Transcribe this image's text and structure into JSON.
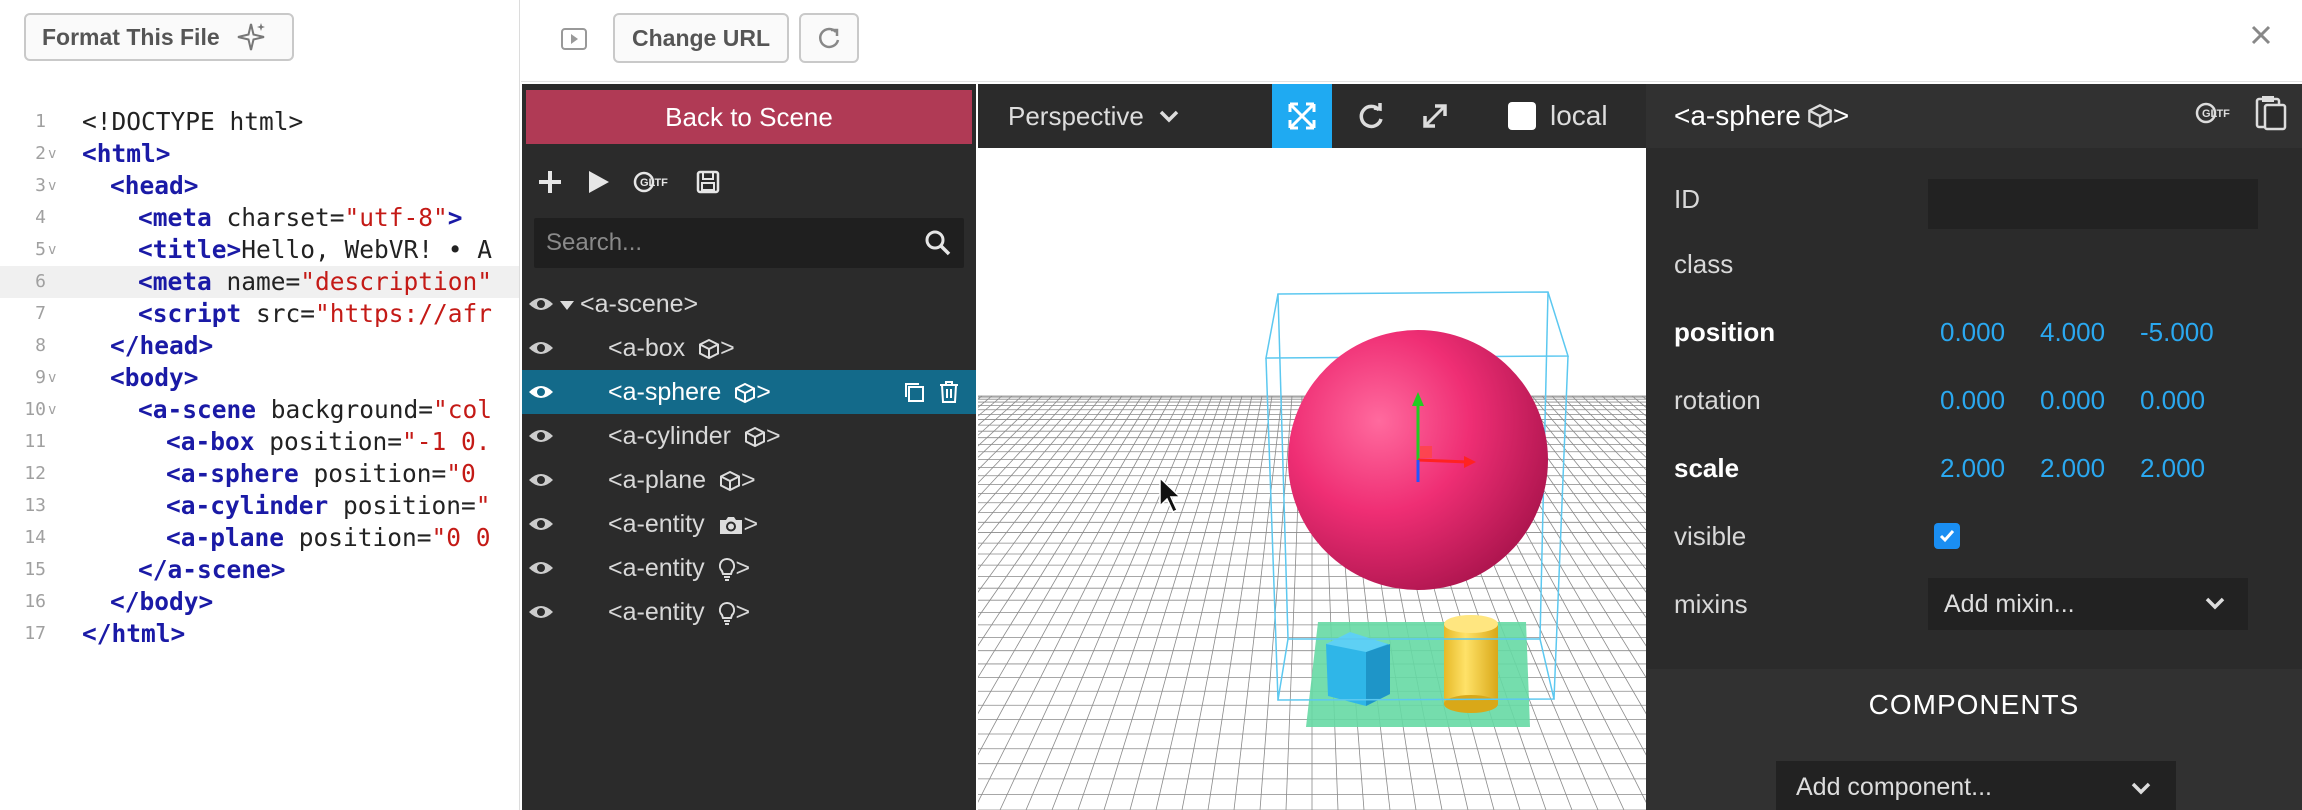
{
  "editor": {
    "format_button": "Format This File",
    "lines": [
      {
        "n": "1",
        "fold": ""
      },
      {
        "n": "2",
        "fold": "v"
      },
      {
        "n": "3",
        "fold": "v"
      },
      {
        "n": "4",
        "fold": ""
      },
      {
        "n": "5",
        "fold": "v"
      },
      {
        "n": "6",
        "fold": ""
      },
      {
        "n": "7",
        "fold": ""
      },
      {
        "n": "8",
        "fold": ""
      },
      {
        "n": "9",
        "fold": "v"
      },
      {
        "n": "10",
        "fold": "v"
      },
      {
        "n": "11",
        "fold": ""
      },
      {
        "n": "12",
        "fold": ""
      },
      {
        "n": "13",
        "fold": ""
      },
      {
        "n": "14",
        "fold": ""
      },
      {
        "n": "15",
        "fold": ""
      },
      {
        "n": "16",
        "fold": ""
      },
      {
        "n": "17",
        "fold": ""
      }
    ],
    "code": {
      "l1": "<!DOCTYPE html>",
      "l2_tag": "<html>",
      "l3_tag": "<head>",
      "l4_tag": "<meta",
      "l4_attr": " charset=",
      "l4_str": "\"utf-8\"",
      "l4_end": ">",
      "l5_tag": "<title>",
      "l5_text": "Hello, WebVR! • A",
      "l6_tag": "<meta",
      "l6_attr": " name=",
      "l6_str": "\"description\"",
      "l7_tag": "<script",
      "l7_attr": " src=",
      "l7_str": "\"https://afr",
      "l8_tag": "</head>",
      "l9_tag": "<body>",
      "l10_tag": "<a-scene",
      "l10_attr": " background=",
      "l10_str": "\"col",
      "l11_tag": "<a-box",
      "l11_attr": " position=",
      "l11_str": "\"-1 0.",
      "l12_tag": "<a-sphere",
      "l12_attr": " position=",
      "l12_str": "\"0",
      "l13_tag": "<a-cylinder",
      "l13_attr": " position=",
      "l13_str": "\"",
      "l14_tag": "<a-plane",
      "l14_attr": " position=",
      "l14_str": "\"0 0",
      "l15_tag": "</a-scene>",
      "l16_tag": "</body>",
      "l17_tag": "</html>"
    }
  },
  "preview_bar": {
    "change_url": "Change URL"
  },
  "scene": {
    "back_button": "Back to Scene",
    "search_placeholder": "Search...",
    "tree": [
      {
        "label": "<a-scene>",
        "icon": "none"
      },
      {
        "label": "<a-box",
        "icon": "cube-icon"
      },
      {
        "label": "<a-sphere",
        "icon": "cube-icon"
      },
      {
        "label": "<a-cylinder",
        "icon": "cube-icon"
      },
      {
        "label": "<a-plane",
        "icon": "cube-icon"
      },
      {
        "label": "<a-entity",
        "icon": "camera-icon"
      },
      {
        "label": "<a-entity",
        "icon": "lightbulb-icon"
      },
      {
        "label": "<a-entity",
        "icon": "lightbulb-icon"
      }
    ],
    "close_bracket": ">"
  },
  "viewport": {
    "camera": "Perspective",
    "local_label": "local"
  },
  "properties": {
    "entity_title": "<a-sphere",
    "entity_title_end": ">",
    "id_label": "ID",
    "class_label": "class",
    "position_label": "position",
    "position": [
      "0.000",
      "4.000",
      "-5.000"
    ],
    "rotation_label": "rotation",
    "rotation": [
      "0.000",
      "0.000",
      "0.000"
    ],
    "scale_label": "scale",
    "scale": [
      "2.000",
      "2.000",
      "2.000"
    ],
    "visible_label": "visible",
    "visible": true,
    "mixins_label": "mixins",
    "mixin_placeholder": "Add mixin...",
    "components_title": "COMPONENTS",
    "add_component": "Add component..."
  },
  "colors": {
    "accent_blue": "#1faaf2",
    "back_button": "#b03a55",
    "selected_row": "#136a8a",
    "number_blue": "#2aa8f0",
    "sphere": "#ef2e74"
  }
}
